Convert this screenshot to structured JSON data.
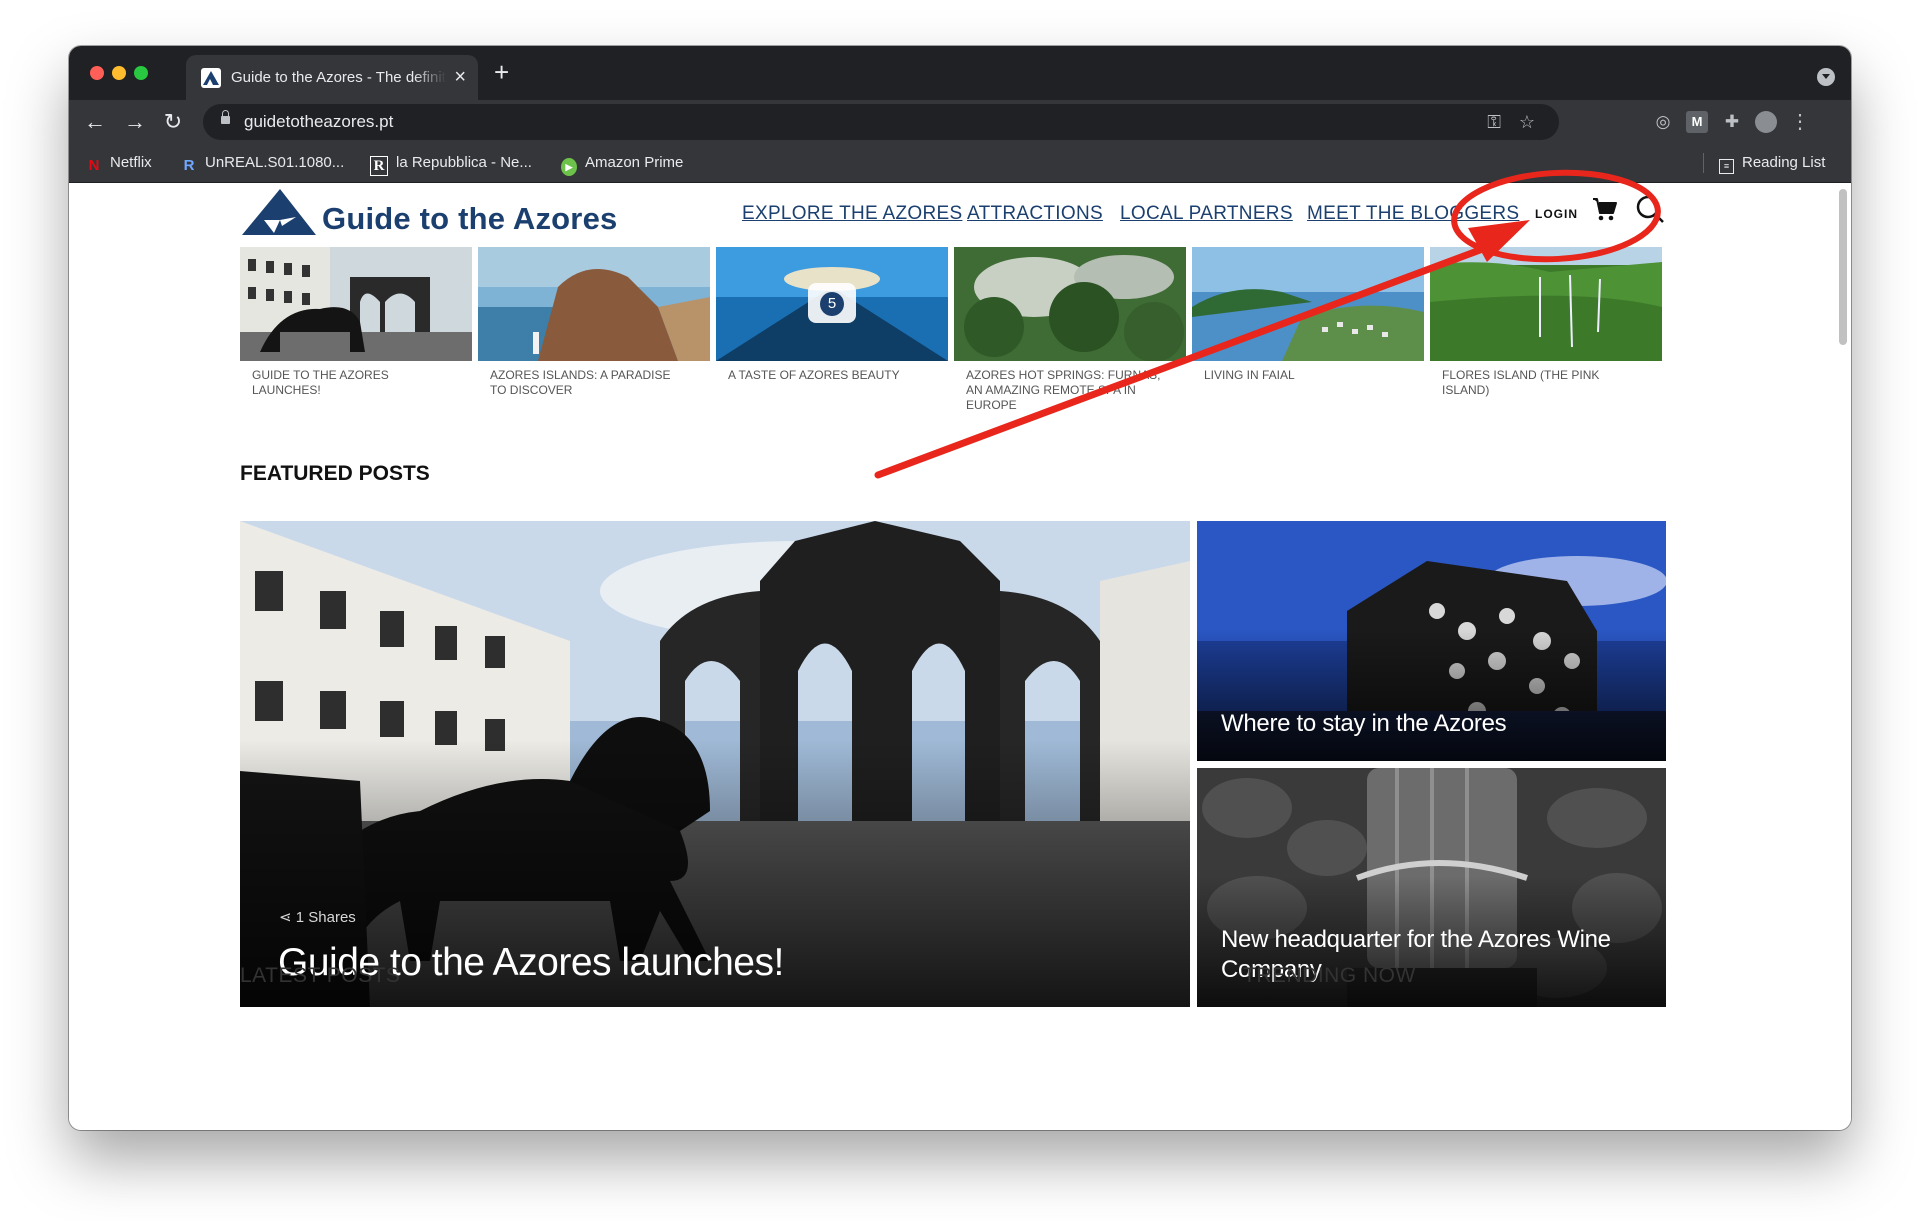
{
  "browser": {
    "tab_title": "Guide to the Azores - The definitive guide to the Azores",
    "url": "guidetotheazores.pt",
    "bookmarks": [
      {
        "label": "Netflix"
      },
      {
        "label": "UnREAL.S01.1080..."
      },
      {
        "label": "la Repubblica - Ne..."
      },
      {
        "label": "Amazon Prime"
      }
    ],
    "reading_list": "Reading List",
    "ext_badge": "M"
  },
  "site": {
    "logo_text": "Guide to the Azores",
    "nav": [
      "EXPLORE THE AZORES",
      "ATTRACTIONS",
      "LOCAL PARTNERS",
      "MEET THE BLOGGERS"
    ],
    "login": "LOGIN"
  },
  "carousel": [
    {
      "caption": "GUIDE TO THE AZORES LAUNCHES!"
    },
    {
      "caption": "AZORES ISLANDS: A PARADISE TO DISCOVER"
    },
    {
      "caption": "A TASTE OF AZORES BEAUTY",
      "gallery_count": "5"
    },
    {
      "caption": "AZORES HOT SPRINGS: FURNAS, AN AMAZING REMOTE SPA IN EUROPE"
    },
    {
      "caption": "LIVING IN FAIAL"
    },
    {
      "caption": "FLORES ISLAND (THE PINK ISLAND)"
    }
  ],
  "featured": {
    "heading": "FEATURED POSTS",
    "main": {
      "title": "Guide to the Azores launches!",
      "shares": "1 Shares"
    },
    "side": [
      {
        "title": "Where to stay in the Azores"
      },
      {
        "title": "New headquarter for the Azores Wine Company"
      }
    ]
  },
  "sections": {
    "latest": "LATEST POSTS",
    "trending": "TRENDING NOW"
  },
  "colors": {
    "brand_navy": "#1b3f6e",
    "annotation_red": "#e8261c"
  }
}
